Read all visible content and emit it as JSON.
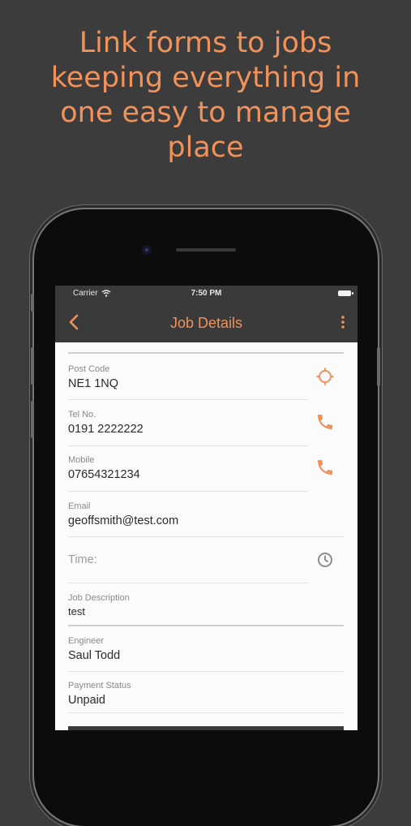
{
  "headline": {
    "lines": [
      "Link forms to jobs",
      "keeping everything in",
      "one easy to manage",
      "place"
    ]
  },
  "status_bar": {
    "carrier": "Carrier",
    "time": "7:50 PM"
  },
  "nav": {
    "title": "Job Details"
  },
  "fields": {
    "post_code": {
      "label": "Post Code",
      "value": "NE1 1NQ",
      "icon": "location-target-icon"
    },
    "tel_no": {
      "label": "Tel No.",
      "value": "0191 2222222",
      "icon": "phone-icon"
    },
    "mobile": {
      "label": "Mobile",
      "value": "07654321234",
      "icon": "phone-icon"
    },
    "email": {
      "label": "Email",
      "value": "geoffsmith@test.com"
    },
    "time": {
      "placeholder": "Time:",
      "icon": "clock-icon"
    },
    "job_description": {
      "label": "Job Description",
      "value": "test"
    },
    "engineer": {
      "label": "Engineer",
      "value": "Saul Todd"
    },
    "payment_status": {
      "label": "Payment Status",
      "value": "Unpaid"
    }
  },
  "colors": {
    "accent": "#f0925a",
    "background": "#3c3c3c",
    "navbar": "#3a3a3a",
    "screen": "#fbfbfb"
  }
}
